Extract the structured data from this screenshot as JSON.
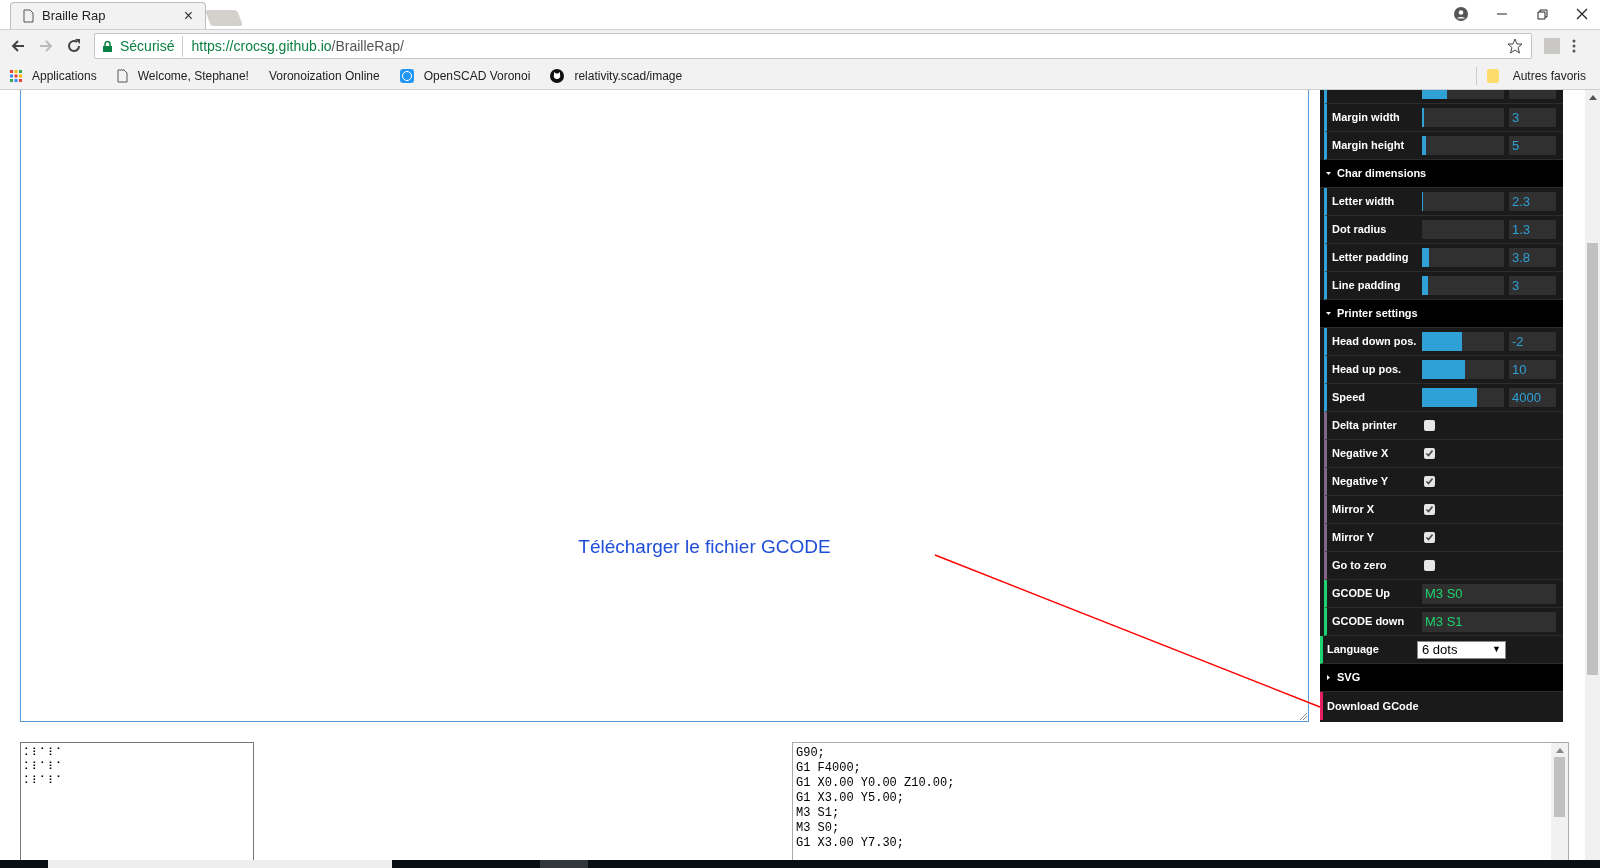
{
  "browser": {
    "tab": {
      "title": "Braille Rap",
      "close": "×"
    },
    "security_label": "Sécurisé",
    "url_host": "https://crocsg.github.io",
    "url_path": "/BrailleRap/",
    "bookmarks": [
      "Applications",
      "Welcome, Stephane!",
      "Voronoization Online",
      "OpenSCAD Voronoi",
      "relativity.scad/image"
    ],
    "other_bookmarks": "Autres favoris"
  },
  "main": {
    "annotation": "Télécharger le fichier GCODE"
  },
  "panel": {
    "rows": [
      {
        "kind": "slider",
        "level": 0.3
      },
      {
        "kind": "slider",
        "label": "Margin width",
        "value": "3",
        "level": 0.02
      },
      {
        "kind": "slider",
        "label": "Margin height",
        "value": "5",
        "level": 0.05
      },
      {
        "kind": "header",
        "label": "Char dimensions",
        "expanded": true
      },
      {
        "kind": "slider",
        "label": "Letter width",
        "value": "2.3",
        "level": 0.01
      },
      {
        "kind": "slider",
        "label": "Dot radius",
        "value": "1.3",
        "level": 0
      },
      {
        "kind": "slider",
        "label": "Letter padding",
        "value": "3.8",
        "level": 0.09
      },
      {
        "kind": "slider",
        "label": "Line padding",
        "value": "3",
        "level": 0.07
      },
      {
        "kind": "header",
        "label": "Printer settings",
        "expanded": true
      },
      {
        "kind": "slider",
        "label": "Head down pos.",
        "value": "-2",
        "level": 0.49
      },
      {
        "kind": "slider",
        "label": "Head up pos.",
        "value": "10",
        "level": 0.53
      },
      {
        "kind": "slider",
        "label": "Speed",
        "value": "4000",
        "level": 0.67
      },
      {
        "kind": "checkbox",
        "label": "Delta printer",
        "checked": false
      },
      {
        "kind": "checkbox",
        "label": "Negative X",
        "checked": true
      },
      {
        "kind": "checkbox",
        "label": "Negative Y",
        "checked": true
      },
      {
        "kind": "checkbox",
        "label": "Mirror X",
        "checked": true
      },
      {
        "kind": "checkbox",
        "label": "Mirror Y",
        "checked": true
      },
      {
        "kind": "checkbox",
        "label": "Go to zero",
        "checked": false
      },
      {
        "kind": "text",
        "label": "GCODE Up",
        "value": "M3 S0"
      },
      {
        "kind": "text",
        "label": "GCODE down",
        "value": "M3 S1"
      },
      {
        "kind": "select",
        "label": "Language",
        "value": "6 dots",
        "arrow": "▼"
      },
      {
        "kind": "header",
        "label": "SVG",
        "expanded": false
      },
      {
        "kind": "button",
        "label": "Download GCode"
      }
    ]
  },
  "braille_output": [
    "⠅⠇⠁⠇⠁",
    "⠅⠇⠁⠇⠁",
    "⠅⠇⠁⠇⠁"
  ],
  "gcode_lines": [
    "G90;",
    "G1 F4000;",
    "G1 X0.00 Y0.00 Z10.00;",
    "G1 X3.00 Y5.00;",
    "M3 S1;",
    "M3 S0;",
    "G1 X3.00 Y7.30;"
  ]
}
